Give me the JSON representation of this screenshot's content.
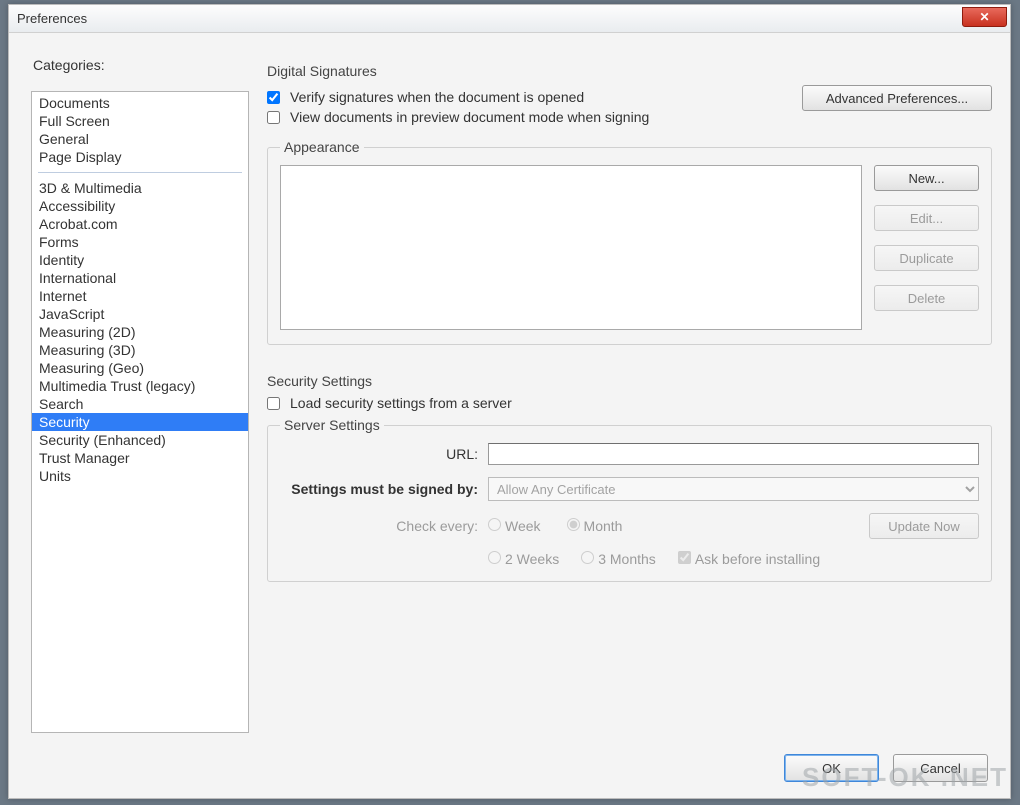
{
  "window": {
    "title": "Preferences"
  },
  "sidebar": {
    "label": "Categories:",
    "group1": [
      "Documents",
      "Full Screen",
      "General",
      "Page Display"
    ],
    "group2": [
      "3D & Multimedia",
      "Accessibility",
      "Acrobat.com",
      "Forms",
      "Identity",
      "International",
      "Internet",
      "JavaScript",
      "Measuring (2D)",
      "Measuring (3D)",
      "Measuring (Geo)",
      "Multimedia Trust (legacy)",
      "Search",
      "Security",
      "Security (Enhanced)",
      "Trust Manager",
      "Units"
    ],
    "selected": "Security"
  },
  "digital_signatures": {
    "title": "Digital Signatures",
    "verify_label": "Verify signatures when the document is opened",
    "verify_checked": true,
    "preview_label": "View documents in preview document mode when signing",
    "preview_checked": false,
    "advanced_btn": "Advanced Preferences...",
    "appearance": {
      "title": "Appearance",
      "buttons": {
        "new": "New...",
        "edit": "Edit...",
        "duplicate": "Duplicate",
        "delete": "Delete"
      }
    }
  },
  "security_settings": {
    "title": "Security Settings",
    "load_label": "Load security settings from a server",
    "load_checked": false,
    "server": {
      "title": "Server Settings",
      "url_label": "URL:",
      "url_value": "",
      "signed_label": "Settings must be signed by:",
      "signed_value": "Allow Any Certificate",
      "check_label": "Check every:",
      "week": "Week",
      "month": "Month",
      "two_weeks": "2 Weeks",
      "three_months": "3 Months",
      "selected_period": "Month",
      "ask_label": "Ask before installing",
      "ask_checked": true,
      "update_btn": "Update Now"
    }
  },
  "footer": {
    "ok": "OK",
    "cancel": "Cancel"
  },
  "watermark": "SOFT-OK .NET"
}
